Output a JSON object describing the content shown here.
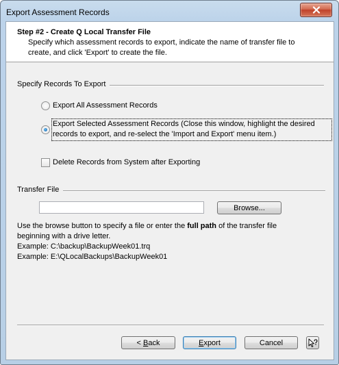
{
  "window": {
    "title": "Export Assessment Records"
  },
  "header": {
    "step_title": "Step #2 - Create Q Local Transfer File",
    "description": "Specify which assessment records to export, indicate the name of transfer file to create, and click 'Export' to create the file."
  },
  "records": {
    "group_label": "Specify Records To Export",
    "option_all": "Export All Assessment Records",
    "option_selected": "Export Selected Assessment Records (Close this window, highlight the desired records to export, and re-select the 'Import and Export' menu item.)",
    "selected_option": "selected",
    "delete_label": "Delete Records from System after Exporting",
    "delete_checked": false
  },
  "transfer": {
    "group_label": "Transfer File",
    "file_value": "",
    "browse_label": "Browse...",
    "help_before": "Use the browse button to specify a file or enter the ",
    "help_bold": "full path",
    "help_after": " of the transfer file beginning with a drive letter.",
    "example1": "Example: C:\\backup\\BackupWeek01.trq",
    "example2": "Example: E:\\QLocalBackups\\BackupWeek01"
  },
  "buttons": {
    "back": "< Back",
    "export": "Export",
    "cancel": "Cancel"
  }
}
